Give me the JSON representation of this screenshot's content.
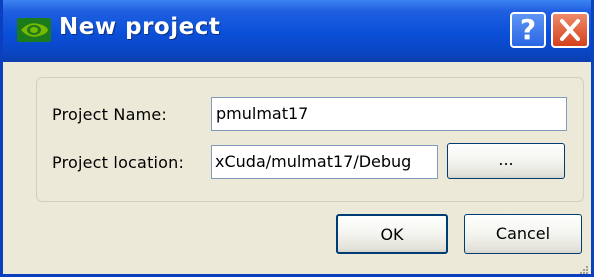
{
  "window": {
    "title": "New project",
    "help_glyph": "?",
    "icons": {
      "app": "nvidia-logo-icon",
      "help": "help-icon",
      "close": "close-icon"
    }
  },
  "form": {
    "project_name_label": "Project Name:",
    "project_name_value": "pmulmat17",
    "project_location_label": "Project location:",
    "project_location_value": "xCuda/mulmat17/Debug",
    "browse_label": "..."
  },
  "buttons": {
    "ok_label": "OK",
    "cancel_label": "Cancel"
  },
  "colors": {
    "titlebar": "#0a4fd8",
    "close_button": "#d4411c",
    "dialog_background": "#ece9d8",
    "field_border": "#7f9db9"
  }
}
